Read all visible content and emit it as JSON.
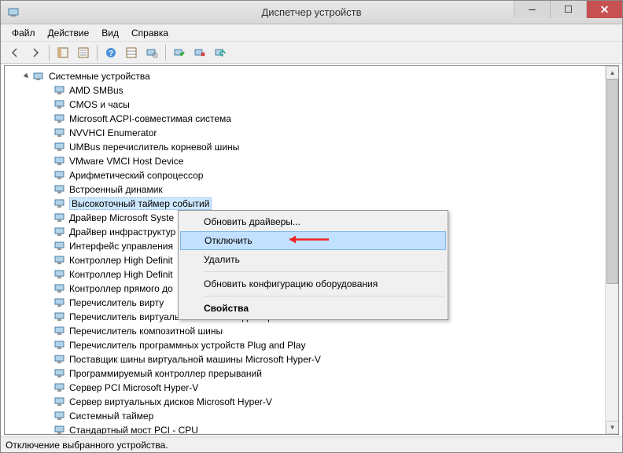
{
  "window": {
    "title": "Диспетчер устройств"
  },
  "menus": [
    {
      "label": "Файл"
    },
    {
      "label": "Действие"
    },
    {
      "label": "Вид"
    },
    {
      "label": "Справка"
    }
  ],
  "tree": {
    "category": "Системные устройства",
    "items": [
      "AMD SMBus",
      "CMOS и часы",
      "Microsoft ACPI-совместимая система",
      "NVVHCI Enumerator",
      "UMBus перечислитель корневой шины",
      "VMware VMCI Host Device",
      "Арифметический сопроцессор",
      "Встроенный динамик",
      "Высокоточный таймер событий",
      "Драйвер Microsoft Syste",
      "Драйвер инфраструктур",
      "Интерфейс управления",
      "Контроллер High Definit",
      "Контроллер High Definit",
      "Контроллер прямого до",
      "Перечислитель вирту",
      "Перечислитель виртуальных сетевых адаптеров NDIS",
      "Перечислитель композитной шины",
      "Перечислитель программных устройств Plug and Play",
      "Поставщик шины виртуальной машины Microsoft Hyper-V",
      "Программируемый контроллер прерываний",
      "Сервер PCI Microsoft Hyper-V",
      "Сервер виртуальных дисков Microsoft Hyper-V",
      "Системный таймер",
      "Стандартный мост PCI - CPU"
    ],
    "selectedIndex": 8
  },
  "contextMenu": {
    "items": [
      {
        "label": "Обновить драйверы...",
        "type": "item"
      },
      {
        "label": "Отключить",
        "type": "item",
        "highlighted": true,
        "arrow": true
      },
      {
        "label": "Удалить",
        "type": "item"
      },
      {
        "type": "sep"
      },
      {
        "label": "Обновить конфигурацию оборудования",
        "type": "item"
      },
      {
        "type": "sep"
      },
      {
        "label": "Свойства",
        "type": "item",
        "bold": true
      }
    ]
  },
  "statusbar": {
    "text": "Отключение выбранного устройства."
  }
}
